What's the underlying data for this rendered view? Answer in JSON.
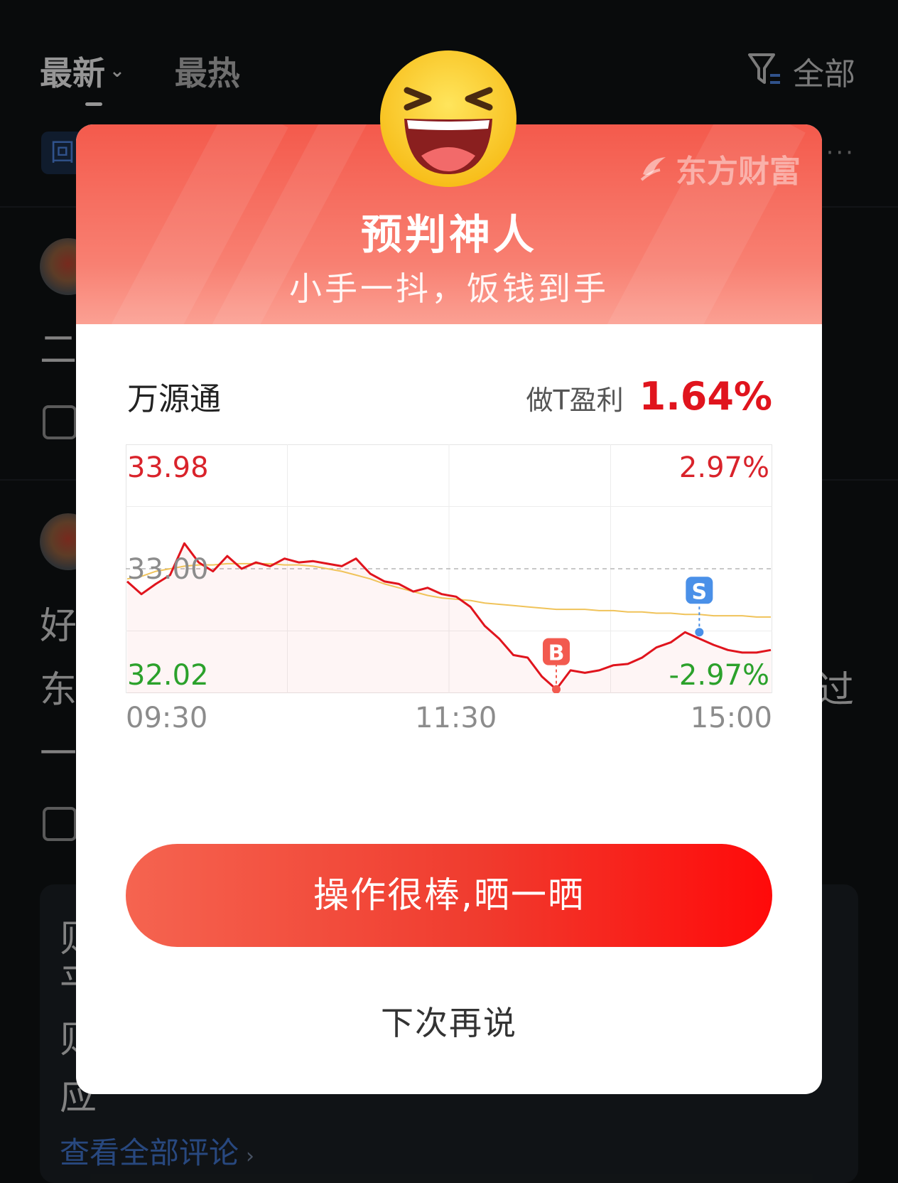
{
  "background": {
    "tabs": [
      {
        "label": "最新",
        "active": true
      },
      {
        "label": "最热",
        "active": false
      }
    ],
    "filter_label": "全部",
    "chip_label": "回",
    "more_label": "···",
    "post_texts": [
      "二",
      "好",
      "东",
      "一",
      "过",
      "则",
      "平",
      "则",
      "应"
    ],
    "view_all_label": "查看全部评论",
    "view_all_arrow": "›"
  },
  "modal": {
    "brand": "东方财富",
    "title": "预判神人",
    "subtitle": "小手一抖，饭钱到手",
    "stock_name": "万源通",
    "profit_label": "做T盈利",
    "profit_value": "1.64%",
    "share_button": "操作很棒,晒一晒",
    "later_button": "下次再说"
  },
  "chart_data": {
    "type": "line",
    "x_labels": [
      "09:30",
      "11:30",
      "15:00"
    ],
    "y_left_labels": {
      "top": "33.98",
      "mid": "33.00",
      "bottom": "32.02"
    },
    "y_right_labels": {
      "top": "2.97%",
      "bottom": "-2.97%"
    },
    "ylim": [
      32.02,
      33.98
    ],
    "prev_close": 33.0,
    "series": [
      {
        "values": [
          32.9,
          32.8,
          32.88,
          32.95,
          33.2,
          33.05,
          32.98,
          33.1,
          33.0,
          33.05,
          33.02,
          33.08,
          33.05,
          33.06,
          33.04,
          33.02,
          33.08,
          32.96,
          32.9,
          32.88,
          32.82,
          32.85,
          32.8,
          32.78,
          32.7,
          32.55,
          32.45,
          32.32,
          32.3,
          32.15,
          32.05,
          32.2,
          32.18,
          32.2,
          32.24,
          32.25,
          32.3,
          32.38,
          32.42,
          32.5,
          32.45,
          32.4,
          32.36,
          32.34,
          32.34,
          32.36
        ]
      },
      {
        "values": [
          32.92,
          32.94,
          32.98,
          33.0,
          33.02,
          33.03,
          33.03,
          33.04,
          33.04,
          33.04,
          33.04,
          33.03,
          33.03,
          33.02,
          33.0,
          32.98,
          32.95,
          32.92,
          32.88,
          32.85,
          32.82,
          32.79,
          32.77,
          32.76,
          32.75,
          32.73,
          32.72,
          32.71,
          32.7,
          32.69,
          32.68,
          32.68,
          32.68,
          32.67,
          32.67,
          32.66,
          32.66,
          32.65,
          32.65,
          32.64,
          32.64,
          32.63,
          32.63,
          32.63,
          32.62,
          32.62
        ]
      }
    ],
    "markers": [
      {
        "label": "B",
        "index": 30,
        "price": 32.05,
        "color": "#f25a4f"
      },
      {
        "label": "S",
        "index": 40,
        "price": 32.5,
        "color": "#4a90e8"
      }
    ],
    "colors": {
      "price_line": "#e0141d",
      "avg_line": "#f0c35a",
      "up_text": "#d9232b",
      "down_text": "#2ba12b",
      "mid_text": "#8c8c8c"
    },
    "grid": true
  }
}
